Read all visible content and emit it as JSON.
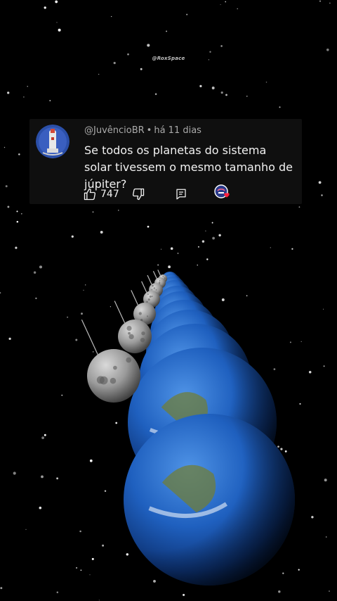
{
  "watermark": "@RoxSpace",
  "comment": {
    "author": "@JuvêncioBR",
    "separator": "•",
    "time": "há 11 dias",
    "text": "Se todos os planetas do sistema solar tivessem o mesmo tamanho de júpiter?",
    "likes": "747"
  },
  "icons": {
    "like": "thumbs-up-icon",
    "dislike": "thumbs-down-icon",
    "reply": "reply-comment-icon",
    "creator_heart": "creator-heart-icon"
  },
  "colors": {
    "background": "#000000",
    "card": "#0f0f0f",
    "meta_text": "#aaaaaa",
    "heart": "#ff1e3c",
    "earth_ocean": "#1d5fb8",
    "moon_gray": "#9a9a9a"
  }
}
